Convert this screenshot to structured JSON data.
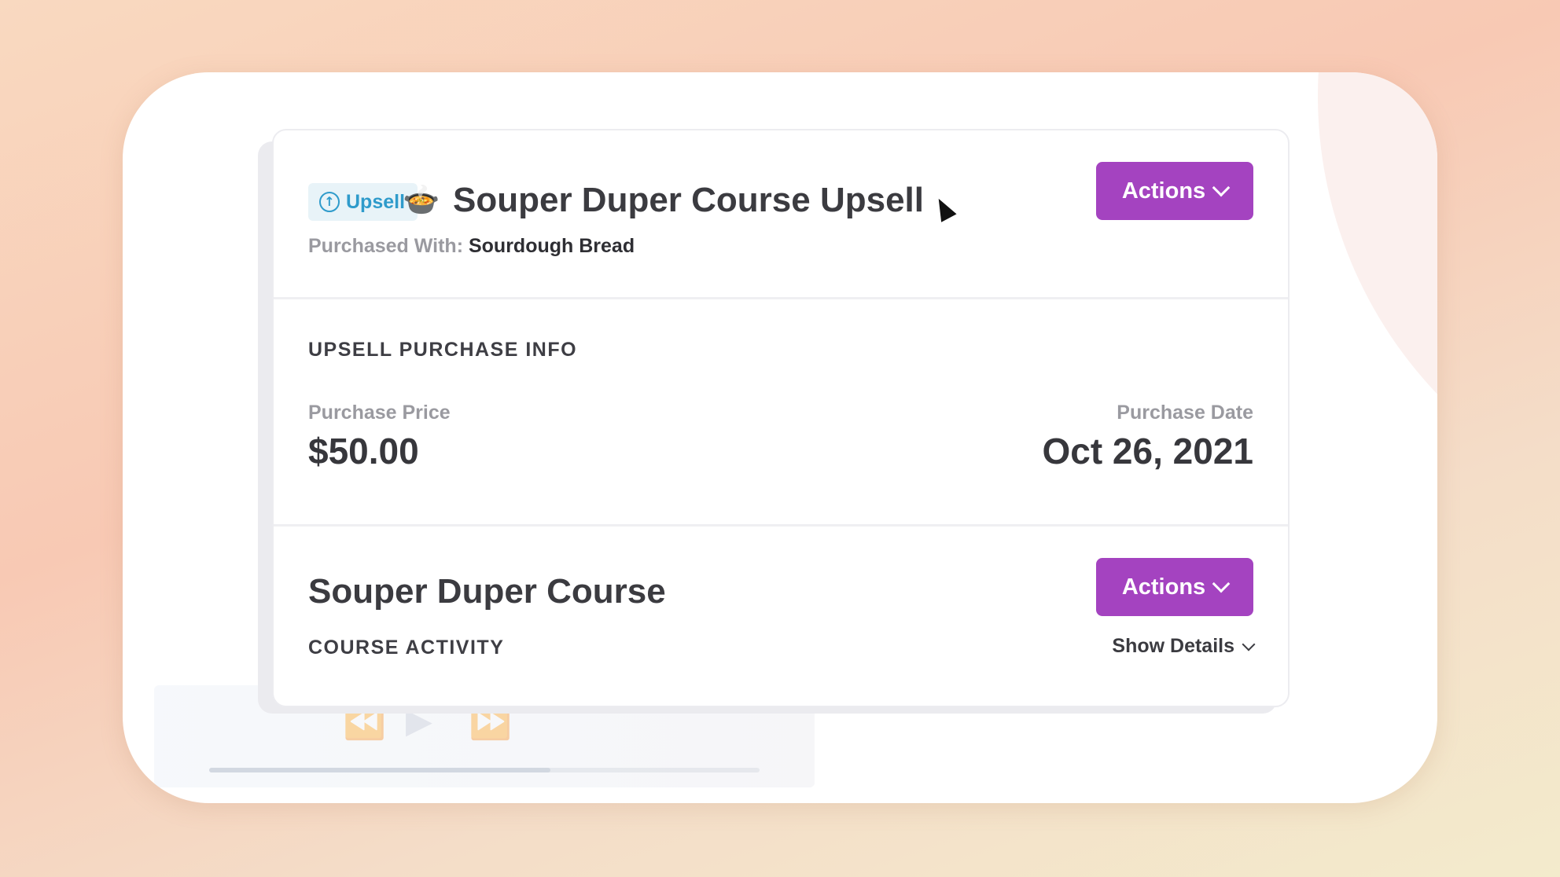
{
  "header": {
    "badge_label": "Upsell",
    "badge_icon": "arrow-up-circle-icon",
    "product_icon": "soup-bowl-icon",
    "title": "Souper Duper Course Upsell",
    "purchased_with_label": "Purchased With:",
    "purchased_with_value": "Sourdough Bread",
    "actions_label": "Actions"
  },
  "purchase_info": {
    "heading": "UPSELL PURCHASE INFO",
    "price_label": "Purchase Price",
    "price_value": "$50.00",
    "date_label": "Purchase Date",
    "date_value": "Oct 26, 2021"
  },
  "course": {
    "title": "Souper Duper Course",
    "actions_label": "Actions",
    "activity_heading": "COURSE ACTIVITY",
    "show_details_label": "Show Details"
  },
  "colors": {
    "accent": "#a443c0",
    "badge_text": "#2f9bcb",
    "badge_bg": "#e8f3f8"
  }
}
